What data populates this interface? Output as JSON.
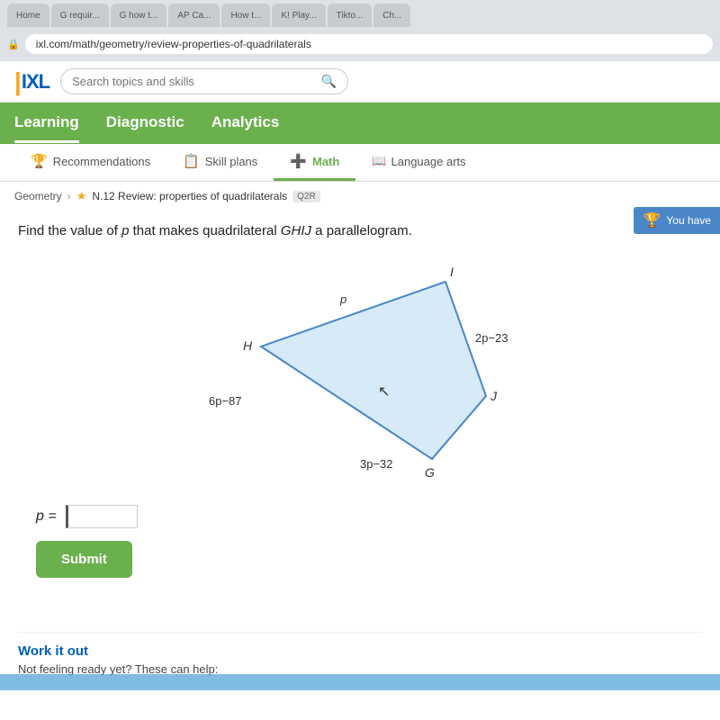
{
  "browser": {
    "url": "ixl.com/math/geometry/review-properties-of-quadrilaterals",
    "tabs": [
      {
        "label": "Home",
        "active": false
      },
      {
        "label": "G requir...",
        "active": false
      },
      {
        "label": "G how t...",
        "active": false
      },
      {
        "label": "AP Ca...",
        "active": false
      },
      {
        "label": "How t...",
        "active": false
      },
      {
        "label": "K! Play...",
        "active": false
      },
      {
        "label": "Tikto...",
        "active": false
      },
      {
        "label": "Ch...",
        "active": false
      }
    ]
  },
  "header": {
    "logo_text": "IXL",
    "search_placeholder": "Search topics and skills"
  },
  "nav": {
    "items": [
      {
        "label": "Learning",
        "active": true
      },
      {
        "label": "Diagnostic",
        "active": false
      },
      {
        "label": "Analytics",
        "active": false
      }
    ]
  },
  "sub_nav": {
    "items": [
      {
        "label": "Recommendations",
        "icon": "🏆",
        "active": false
      },
      {
        "label": "Skill plans",
        "icon": "📋",
        "active": false
      },
      {
        "label": "Math",
        "icon": "➕",
        "active": true
      },
      {
        "label": "Language arts",
        "icon": "📖",
        "active": false
      }
    ]
  },
  "breadcrumb": {
    "parent": "Geometry",
    "skill": "N.12 Review: properties of quadrilaterals",
    "badge": "Q2R"
  },
  "you_have": "You have",
  "question": {
    "text": "Find the value of p that makes quadrilateral GHIJ a parallelogram.",
    "italic_word": "p",
    "labels": {
      "I": "I",
      "H": "H",
      "G": "G",
      "J": "J",
      "top": "p",
      "right": "2p−23",
      "bottom": "3p−32",
      "left": "6p−87"
    }
  },
  "answer": {
    "label": "p =",
    "placeholder": ""
  },
  "submit_button": "Submit",
  "work_it_out": {
    "title": "Work it out",
    "subtitle": "Not feeling ready yet? These can help:"
  }
}
